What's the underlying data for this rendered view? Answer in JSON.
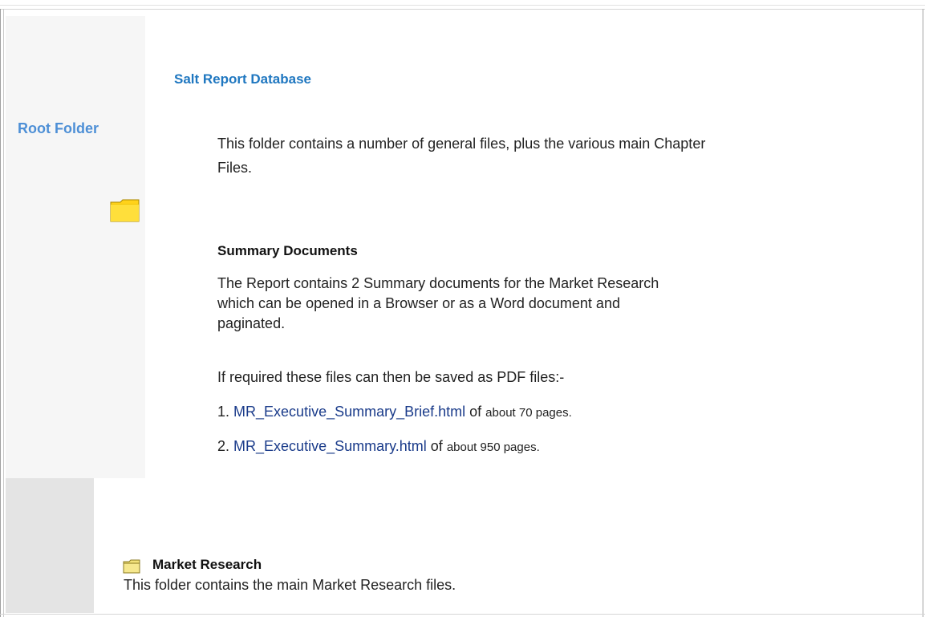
{
  "header": {
    "title": "Salt Report Database"
  },
  "sidebar": {
    "root_label": "Root Folder",
    "root_icon": "folder-icon"
  },
  "root_section": {
    "intro": "This folder contains a number of general files, plus the various main Chapter Files."
  },
  "summary": {
    "heading": "Summary Documents",
    "body": "The Report contains 2 Summary documents for the Market Research which can be opened in a Browser or as a Word document and paginated.",
    "pdf_note": "If required these files can then be saved as PDF files:-",
    "items": [
      {
        "number": "1.",
        "link": "MR_Executive_Summary_Brief.html",
        "of": "of",
        "pages": "about 70 pages."
      },
      {
        "number": "2.",
        "link": "MR_Executive_Summary.html",
        "of": "of",
        "pages": "about 950 pages."
      }
    ]
  },
  "market_research": {
    "icon": "folder-icon",
    "heading": "Market Research",
    "body": "This folder contains the main Market Research files."
  },
  "colors": {
    "title_blue": "#1f77c0",
    "root_blue": "#4d8fd6",
    "link_blue": "#1a3b8a",
    "folder_yellow": "#ffd21a"
  }
}
